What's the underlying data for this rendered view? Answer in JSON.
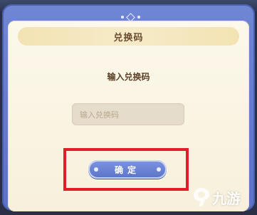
{
  "dialog": {
    "title": "兑换码",
    "prompt": "输入兑换码",
    "input": {
      "value": "",
      "placeholder": "输入兑换码"
    },
    "confirm_label": "确定"
  },
  "watermark": {
    "text": "九游",
    "icon": "nine-game-logo-icon"
  },
  "colors": {
    "frame": "#6a80d0",
    "panel": "#fbf6e6",
    "title_bar": "#f4e6bb",
    "button": "#6c84d6",
    "highlight": "#e21d2a"
  }
}
